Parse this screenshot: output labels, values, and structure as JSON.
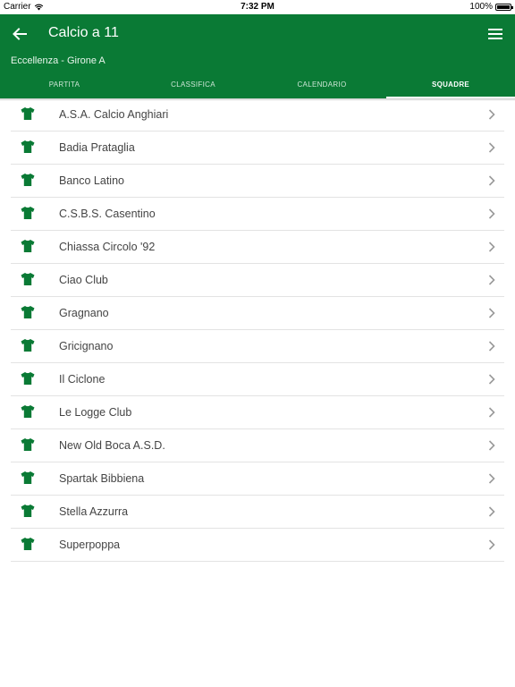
{
  "status": {
    "carrier": "Carrier",
    "time": "7:32 PM",
    "battery": "100%"
  },
  "header": {
    "title": "Calcio a 11",
    "subtitle": "Eccellenza - Girone A",
    "accent": "#0a7a35"
  },
  "tabs": [
    {
      "label": "PARTITA"
    },
    {
      "label": "CLASSIFICA"
    },
    {
      "label": "CALENDARIO"
    },
    {
      "label": "SQUADRE"
    }
  ],
  "teams": [
    {
      "name": "A.S.A. Calcio Anghiari"
    },
    {
      "name": "Badia Prataglia"
    },
    {
      "name": "Banco Latino"
    },
    {
      "name": "C.S.B.S. Casentino"
    },
    {
      "name": "Chiassa Circolo '92"
    },
    {
      "name": "Ciao Club"
    },
    {
      "name": "Gragnano"
    },
    {
      "name": "Gricignano"
    },
    {
      "name": "Il Ciclone"
    },
    {
      "name": "Le Logge Club"
    },
    {
      "name": "New Old Boca A.S.D."
    },
    {
      "name": "Spartak Bibbiena"
    },
    {
      "name": "Stella Azzurra"
    },
    {
      "name": "Superpoppa"
    }
  ]
}
